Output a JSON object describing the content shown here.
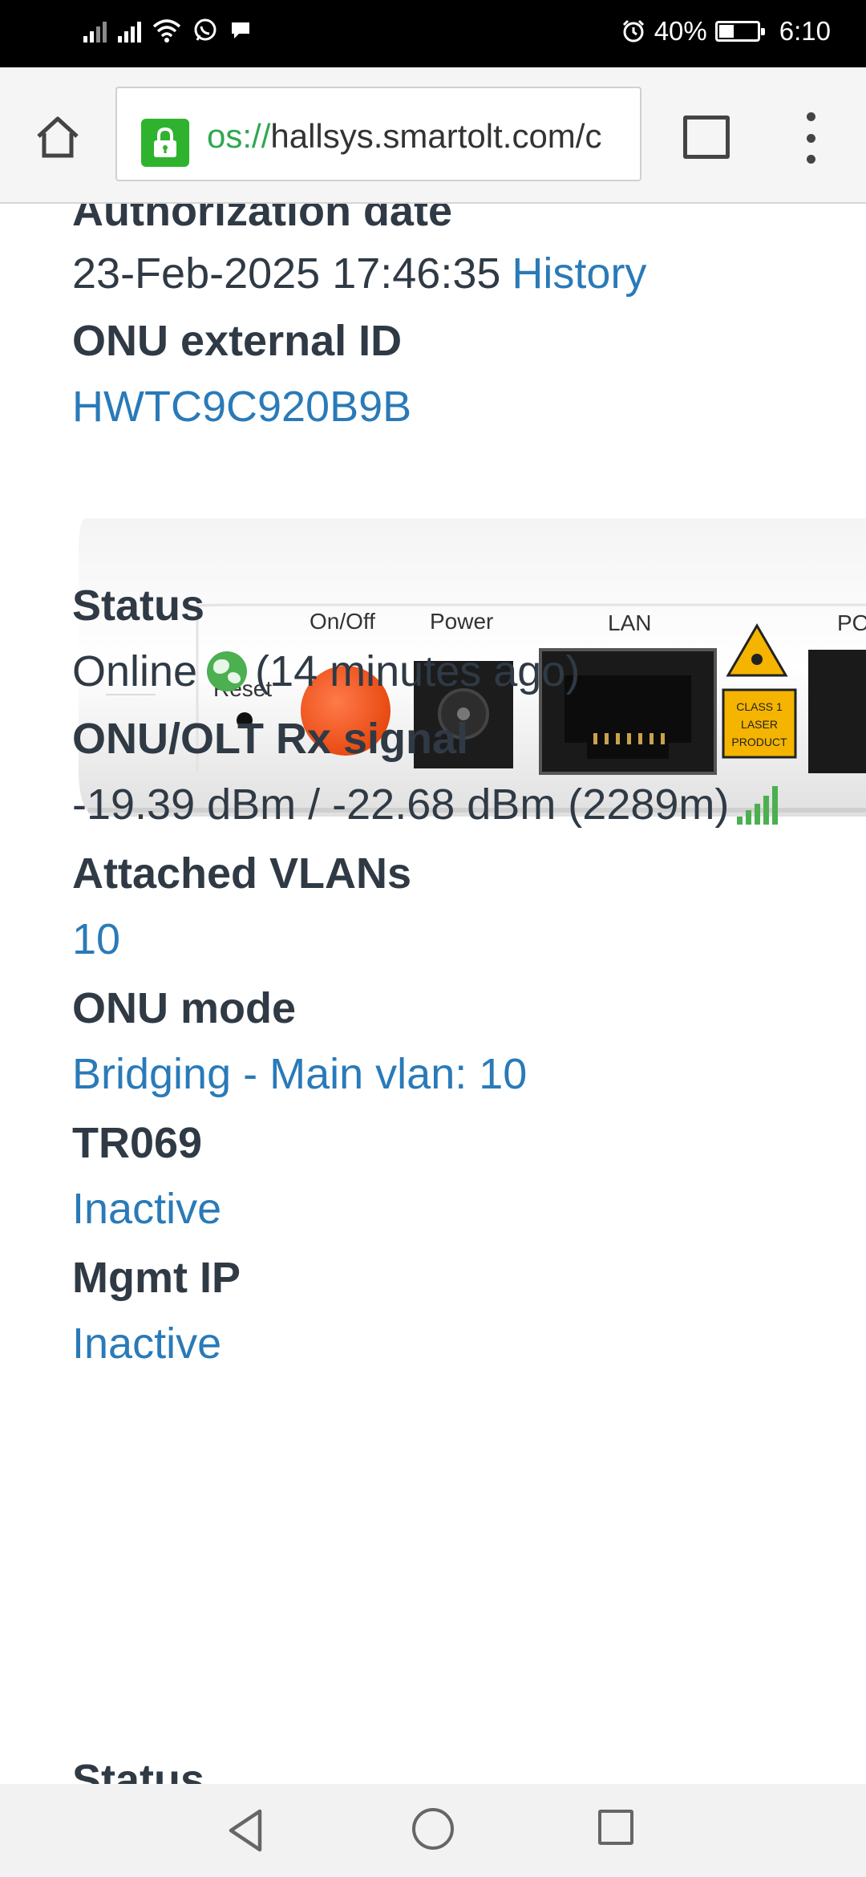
{
  "status_bar": {
    "battery": "40%",
    "time": "6:10",
    "battery_level": 0.4
  },
  "browser": {
    "url_scheme": "os://",
    "url_rest": "hallsys.smartolt.com/c"
  },
  "fields": {
    "authorization_date": {
      "label": "Authorization date",
      "value": "23-Feb-2025 17:46:35",
      "history_link": "History"
    },
    "onu_external_id": {
      "label": "ONU external ID",
      "value": "HWTC9C920B9B"
    },
    "status": {
      "label": "Status",
      "value": "Online",
      "since": "(14 minutes ago)"
    },
    "rx_signal": {
      "label": "ONU/OLT Rx signal",
      "value": "-19.39 dBm / -22.68 dBm (2289m)"
    },
    "attached_vlans": {
      "label": "Attached VLANs",
      "value": "10"
    },
    "onu_mode": {
      "label": "ONU mode",
      "value": "Bridging - Main vlan: 10"
    },
    "tr069": {
      "label": "TR069",
      "value": "Inactive"
    },
    "mgmt_ip": {
      "label": "Mgmt IP",
      "value": "Inactive"
    },
    "next_section": {
      "label": "Status"
    }
  },
  "device_image": {
    "labels": {
      "reset": "Reset",
      "onoff": "On/Off",
      "power": "Power",
      "lan": "LAN",
      "pon": "PO",
      "laser_1": "CLASS 1",
      "laser_2": "LASER",
      "laser_3": "PRODUCT"
    }
  },
  "icons": {
    "home": "home-icon",
    "lock": "lock-icon",
    "tabs": "tabs-icon",
    "menu": "more-vert-icon",
    "globe": "globe-icon",
    "signal": "signal-bars-icon"
  },
  "colors": {
    "link": "#2a7ab8",
    "text": "#2f3a45",
    "online_green": "#4caf50",
    "lock_green": "#2fb32f"
  }
}
